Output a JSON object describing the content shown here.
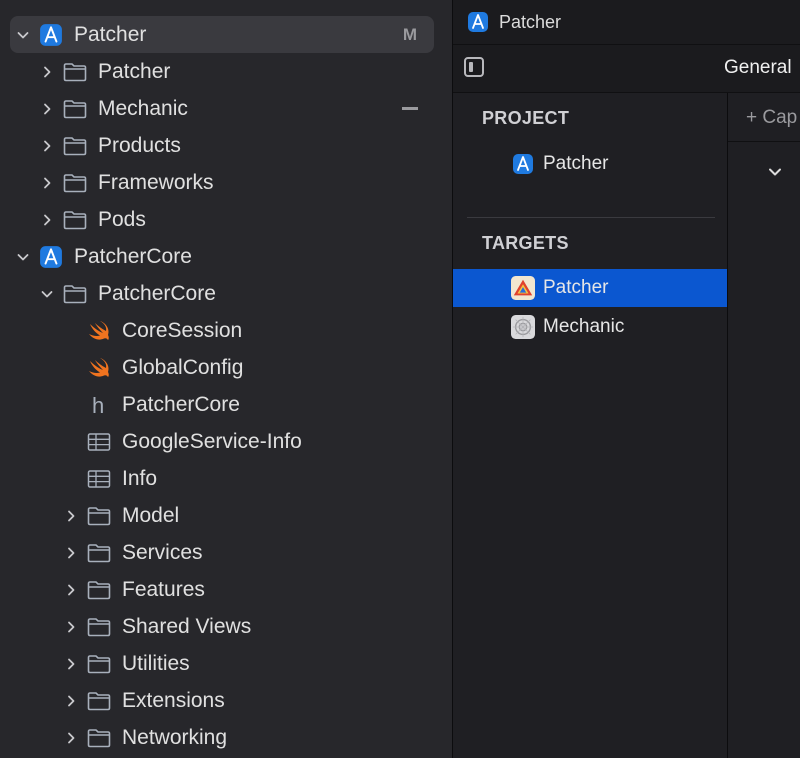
{
  "navigator": {
    "rows": [
      {
        "label": "Patcher",
        "icon": "xcode-project-icon",
        "level": 0,
        "expanded": true,
        "badge": "M",
        "selected": true
      },
      {
        "label": "Patcher",
        "icon": "folder-icon",
        "level": 1,
        "expanded": false
      },
      {
        "label": "Mechanic",
        "icon": "folder-icon",
        "level": 1,
        "expanded": false,
        "badge_dash": true
      },
      {
        "label": "Products",
        "icon": "folder-icon",
        "level": 1,
        "expanded": false
      },
      {
        "label": "Frameworks",
        "icon": "folder-icon",
        "level": 1,
        "expanded": false
      },
      {
        "label": "Pods",
        "icon": "folder-icon",
        "level": 1,
        "expanded": false
      },
      {
        "label": "PatcherCore",
        "icon": "xcode-project-icon",
        "level": 0,
        "expanded": true
      },
      {
        "label": "PatcherCore",
        "icon": "folder-icon",
        "level": 1,
        "expanded": true
      },
      {
        "label": "CoreSession",
        "icon": "swift-file-icon",
        "level": 2
      },
      {
        "label": "GlobalConfig",
        "icon": "swift-file-icon",
        "level": 2
      },
      {
        "label": "PatcherCore",
        "icon": "header-file-icon",
        "level": 2
      },
      {
        "label": "GoogleService-Info",
        "icon": "plist-file-icon",
        "level": 2
      },
      {
        "label": "Info",
        "icon": "plist-file-icon",
        "level": 2
      },
      {
        "label": "Model",
        "icon": "folder-icon",
        "level": 2,
        "expanded": false
      },
      {
        "label": "Services",
        "icon": "folder-icon",
        "level": 2,
        "expanded": false
      },
      {
        "label": "Features",
        "icon": "folder-icon",
        "level": 2,
        "expanded": false
      },
      {
        "label": "Shared Views",
        "icon": "folder-icon",
        "level": 2,
        "expanded": false
      },
      {
        "label": "Utilities",
        "icon": "folder-icon",
        "level": 2,
        "expanded": false
      },
      {
        "label": "Extensions",
        "icon": "folder-icon",
        "level": 2,
        "expanded": false
      },
      {
        "label": "Networking",
        "icon": "folder-icon",
        "level": 2,
        "expanded": false
      }
    ]
  },
  "editor": {
    "title": "Patcher",
    "tab": "General",
    "project_heading": "PROJECT",
    "project_item": "Patcher",
    "targets_heading": "TARGETS",
    "targets": [
      {
        "label": "Patcher",
        "icon": "patcher-app-icon",
        "selected": true
      },
      {
        "label": "Mechanic",
        "icon": "mechanic-app-icon",
        "selected": false
      }
    ],
    "add_capability": "+ Cap"
  },
  "colors": {
    "accent": "#0b57d0",
    "swift_orange": "#f0731f",
    "xcode_blue": "#1f7ae0"
  }
}
